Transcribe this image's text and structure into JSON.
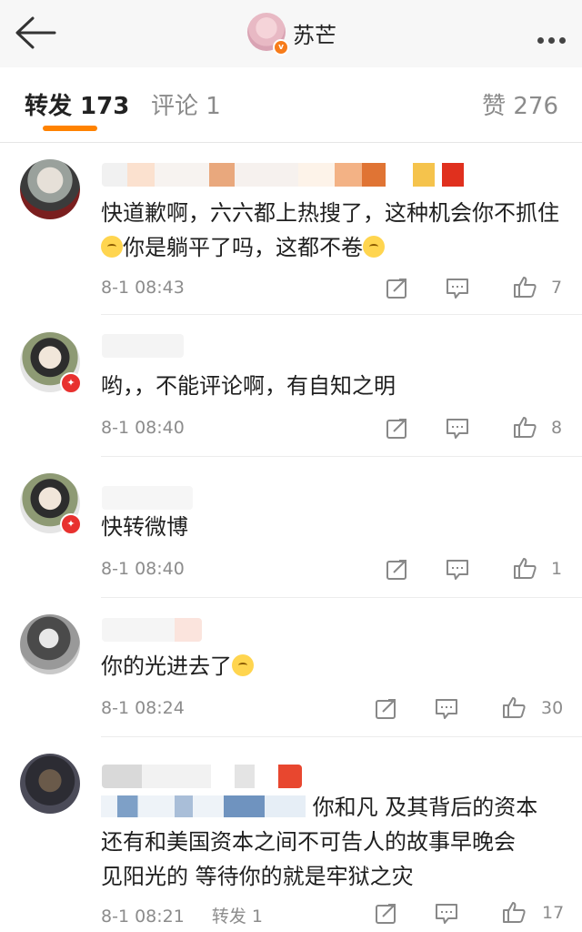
{
  "header": {
    "title": "苏芒",
    "verified_badge": "v"
  },
  "tabs": {
    "repost": "转发 173",
    "comment": "评论 1",
    "like": "赞 276"
  },
  "comments": [
    {
      "text_a": "快道歉啊，六六都上热搜了，这种机会你不抓住",
      "text_b": "你是躺平了吗，这都不卷",
      "time": "8-1 08:43",
      "likes": "7"
    },
    {
      "text": "哟，，不能评论啊，有自知之明",
      "time": "8-1 08:40",
      "likes": "8",
      "badge": "✦"
    },
    {
      "text": "快转微博",
      "time": "8-1 08:40",
      "likes": "1",
      "badge": "✦"
    },
    {
      "text": "你的光进去了",
      "time": "8-1 08:24",
      "likes": "30"
    },
    {
      "text_tail": "你和凡 及其背后的资本",
      "text_line2": "还有和美国资本之间不可告人的故事早晚会",
      "text_line3": "见阳光的 等待你的就是牢狱之灾",
      "time": "8-1 08:21",
      "repost": "转发 1",
      "likes": "17"
    }
  ],
  "colors": {
    "accent": "#ff8200",
    "meta": "#8c8c8c",
    "mention": "#507daf"
  }
}
